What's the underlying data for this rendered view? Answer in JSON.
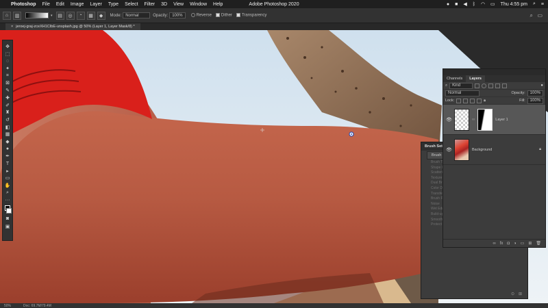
{
  "menubar": {
    "apple_icon": "apple-icon",
    "app_name": "Photoshop",
    "items": [
      "File",
      "Edit",
      "Image",
      "Layer",
      "Type",
      "Select",
      "Filter",
      "3D",
      "View",
      "Window",
      "Help"
    ],
    "center_title": "Adobe Photoshop 2020",
    "clock": "Thu 4:55 pm"
  },
  "options": {
    "mode_label": "Mode:",
    "mode_value": "Normal",
    "opacity_label": "Opacity:",
    "opacity_value": "100%",
    "reverse_label": "Reverse",
    "dither_label": "Dither",
    "transparency_label": "Transparency"
  },
  "document": {
    "tab_title": "jeroej-graj-zceXH1CIbE-unsplash.jpg @ 50% (Layer 1, Layer Mask/8) *"
  },
  "status": {
    "zoom": "50%",
    "doc": "Doc: 69.7M/79.4M"
  },
  "layers_panel": {
    "tabs": [
      "Channels",
      "Layers"
    ],
    "active_tab": "Layers",
    "filter_value": "Kind",
    "blend_mode": "Normal",
    "opacity_label": "Opacity:",
    "opacity_value": "100%",
    "lock_label": "Lock:",
    "fill_label": "Fill:",
    "fill_value": "100%",
    "layers": [
      {
        "name": "Layer 1",
        "active": true
      },
      {
        "name": "Background",
        "active": false
      }
    ]
  },
  "brush_panel": {
    "title": "Brush Settings",
    "tab_label": "Brush",
    "items": [
      "Brush Tip Shape",
      "Shape Dynamics",
      "Scattering",
      "Texture",
      "Dual Brush",
      "Color Dynamics",
      "Transfer",
      "Brush Pose",
      "Noise",
      "Wet Edges",
      "Build-up",
      "Smoothing",
      "Protect Texture"
    ]
  },
  "colors": {
    "swimsuit": "#d9201b",
    "skin": "#b95a43",
    "sky": "#dde9f0",
    "ui_panel": "#3c3c3c"
  }
}
